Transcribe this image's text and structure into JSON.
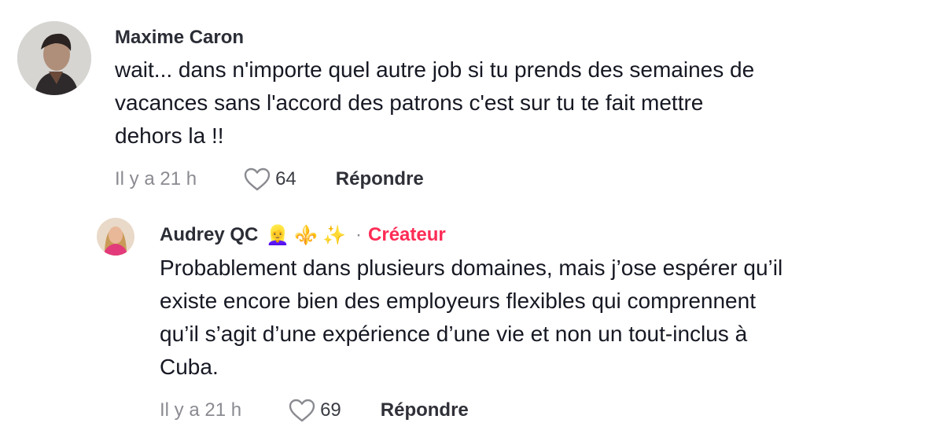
{
  "comments": [
    {
      "author": "Maxime Caron",
      "lines": [
        "wait... dans n'importe quel autre job si tu prends des semaines de",
        "vacances sans l'accord des patrons c'est sur tu te fait mettre",
        "dehors la !!"
      ],
      "time": "Il y a 21 h",
      "likes": "64",
      "reply_label": "Répondre"
    }
  ],
  "replies": [
    {
      "author": "Audrey QC",
      "emojis": [
        "👱‍♀️",
        "⚜️",
        "✨"
      ],
      "separator": "·",
      "creator_label": "Créateur",
      "lines": [
        "Probablement dans plusieurs domaines, mais j’ose espérer qu’il",
        "existe encore bien des employeurs flexibles qui comprennent",
        "qu’il s’agit d’une expérience d’une vie et non un tout-inclus à",
        "Cuba."
      ],
      "time": "Il y a 21 h",
      "likes": "69",
      "reply_label": "Répondre"
    }
  ],
  "colors": {
    "creator": "#fe2c55",
    "muted": "#8a8b91",
    "text": "#161823"
  },
  "icons": {
    "like": "heart-outline-icon"
  }
}
